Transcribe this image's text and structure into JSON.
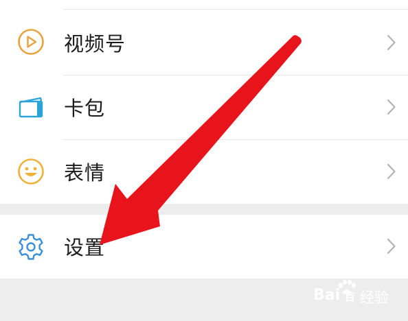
{
  "menu": {
    "items": [
      {
        "label": "视频号",
        "icon": "play-circle-icon",
        "icon_color": "#e8a33d"
      },
      {
        "label": "卡包",
        "icon": "card-wallet-icon",
        "icon_color": "#2aa5d8"
      },
      {
        "label": "表情",
        "icon": "smiley-icon",
        "icon_color": "#f0b13a"
      }
    ],
    "settings": {
      "label": "设置",
      "icon": "gear-icon",
      "icon_color": "#3a8fd8"
    }
  },
  "annotation": {
    "color": "#e8141b",
    "icon": "red-arrow-pointer"
  },
  "watermark": {
    "brand": "Bai",
    "brand_suffix": "百",
    "product": "经验"
  }
}
